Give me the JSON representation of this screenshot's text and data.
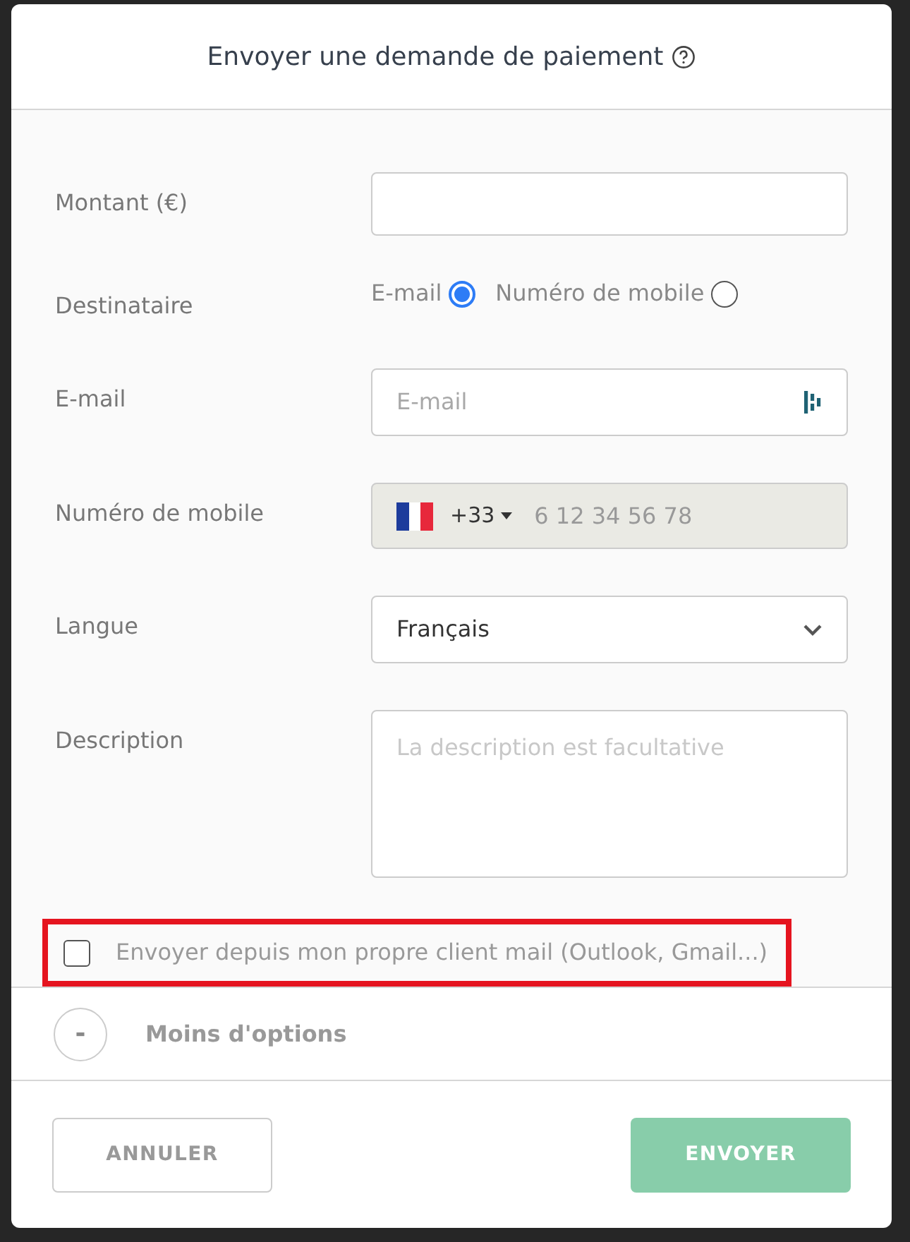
{
  "dialog": {
    "title": "Envoyer une demande de paiement"
  },
  "fields": [
    {
      "kind": "text",
      "label": "Montant (€)"
    },
    {
      "kind": "radio",
      "label": "Destinataire",
      "options": [
        {
          "label": "E-mail",
          "selected": true
        },
        {
          "label": "Numéro de mobile",
          "selected": false
        }
      ]
    },
    {
      "kind": "email",
      "label": "E-mail",
      "placeholder": "E-mail"
    },
    {
      "kind": "phone",
      "label": "Numéro de mobile",
      "country_code": "+33",
      "placeholder": "6 12 34 56 78",
      "disabled": true
    },
    {
      "kind": "select",
      "label": "Langue",
      "value": "Français"
    },
    {
      "kind": "textarea",
      "label": "Description",
      "placeholder": "La description est facultative"
    }
  ],
  "own_client": {
    "label": "Envoyer depuis mon propre client mail (Outlook, Gmail...)",
    "checked": false,
    "highlighted": true
  },
  "options_toggle": {
    "symbol": "-",
    "label": "Moins d'options",
    "expanded": true
  },
  "buttons": [
    {
      "kind": "secondary",
      "label": "ANNULER"
    },
    {
      "kind": "primary",
      "label": "ENVOYER",
      "disabled": true
    }
  ]
}
